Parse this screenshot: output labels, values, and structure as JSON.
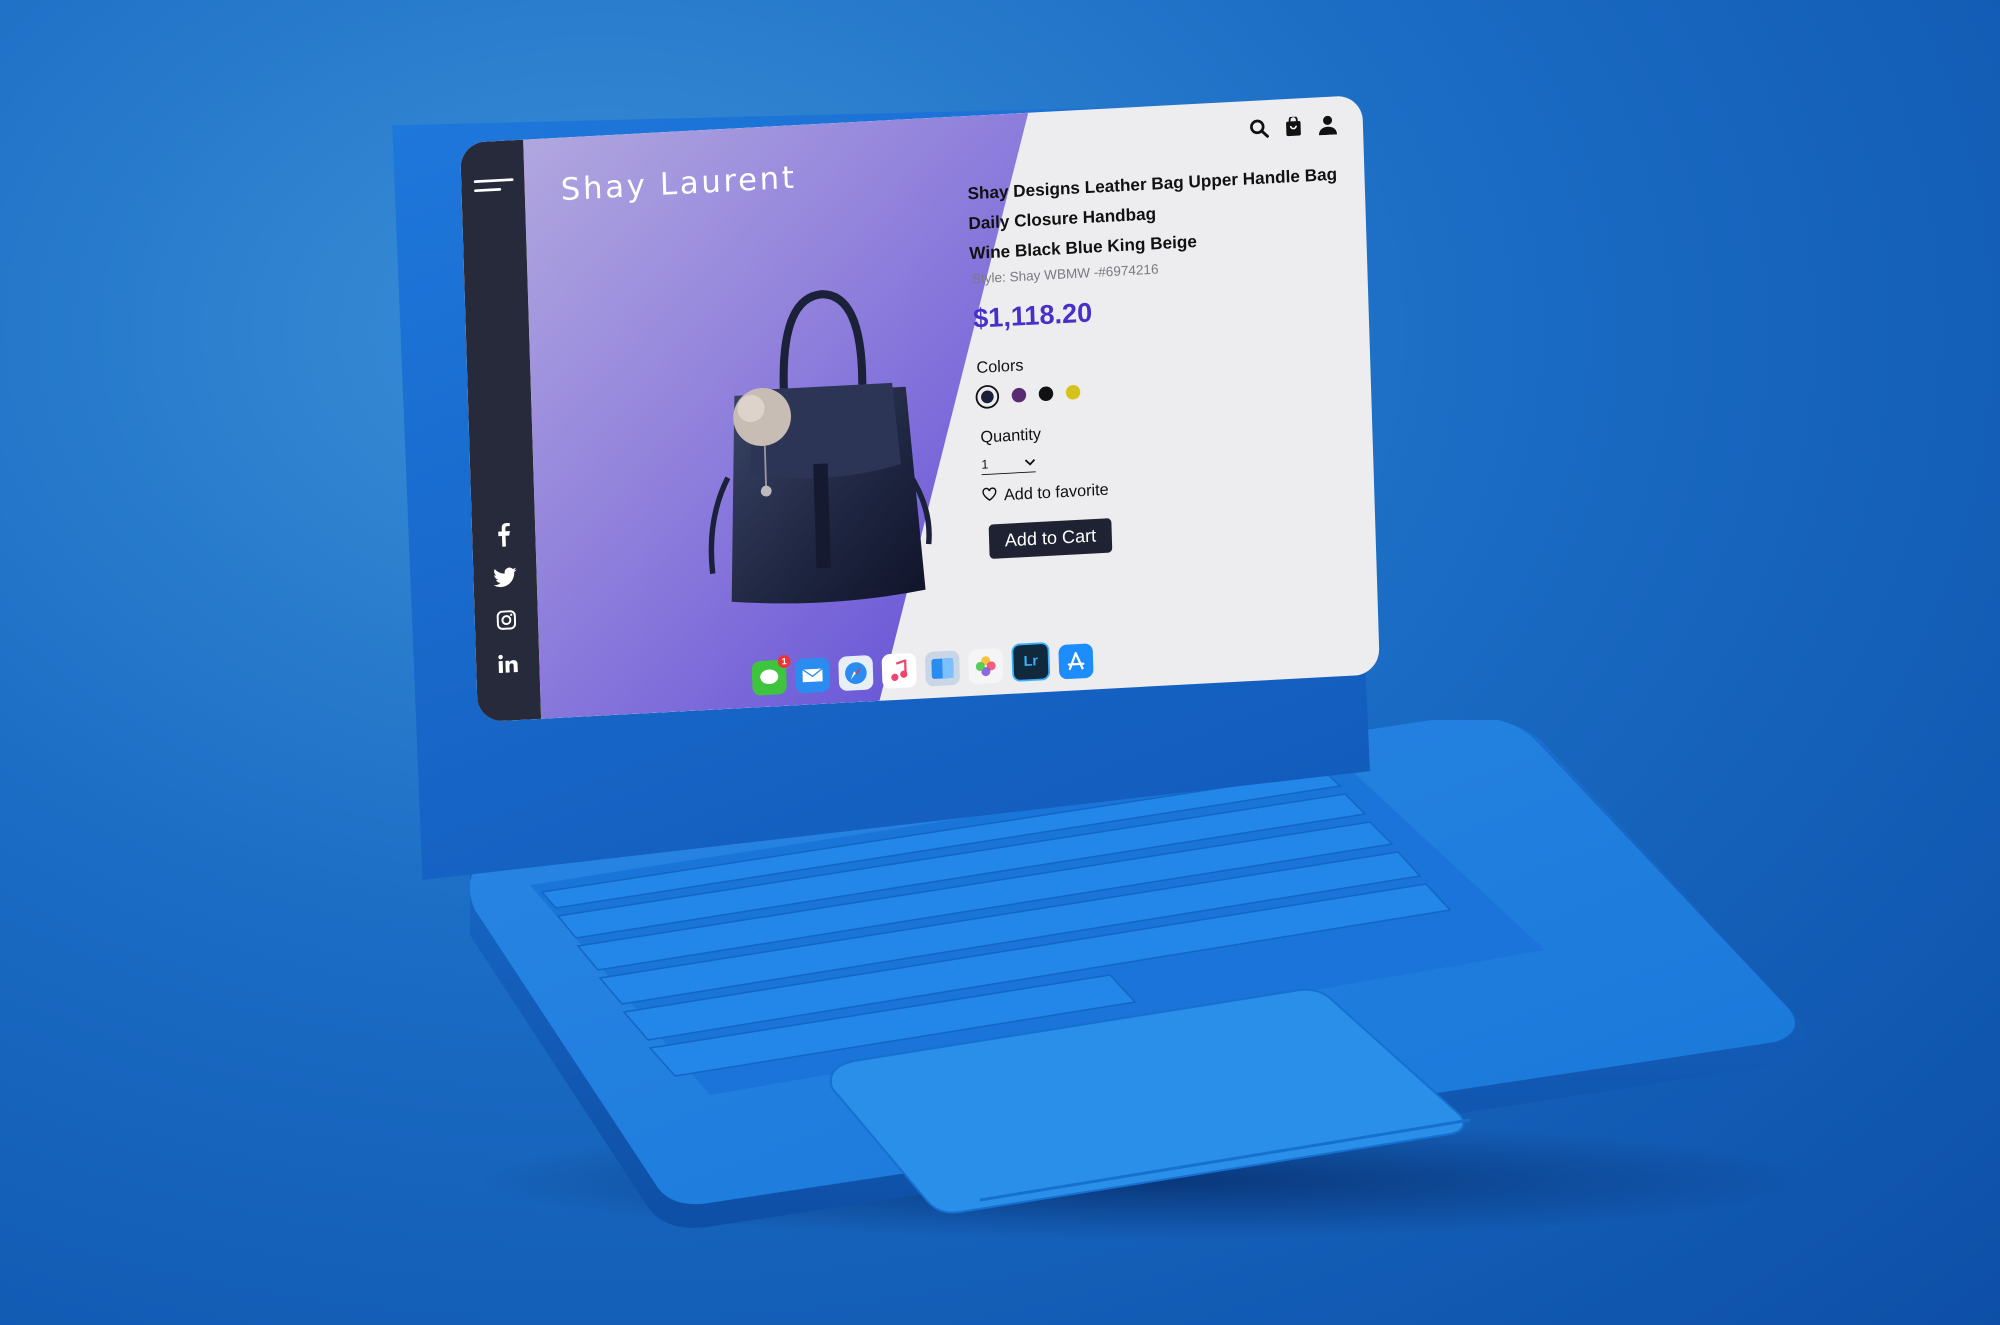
{
  "brand": {
    "name": "Shay Laurent"
  },
  "header_icons": [
    "search-icon",
    "shopping-bag-icon",
    "user-icon"
  ],
  "product": {
    "title_lines": [
      "Shay Designs Leather Bag Upper Handle Bag",
      "Daily Closure Handbag",
      "Wine Black Blue King Beige"
    ],
    "style_code": "Style: Shay WBMW -#6974216",
    "price": "$1,118.20",
    "colors_label": "Colors",
    "colors": [
      "#1b1f3b",
      "#5a2a72",
      "#111111",
      "#d6c21a"
    ],
    "selected_color_index": 0,
    "quantity_label": "Quantity",
    "quantity_value": "1",
    "favorite_label": "Add to favorite",
    "cart_label": "Add to Cart"
  },
  "social": [
    "facebook-icon",
    "twitter-icon",
    "instagram-icon",
    "linkedin-icon"
  ],
  "dock": {
    "apps": [
      "messages",
      "mail",
      "safari",
      "music",
      "finder",
      "photos",
      "lightroom",
      "app-store"
    ],
    "messages_badge": "1",
    "lightroom_label": "Lr"
  },
  "colors": {
    "accent": "#4730c8",
    "sidebar": "#262a3a",
    "laptop": "#1f78dc"
  }
}
